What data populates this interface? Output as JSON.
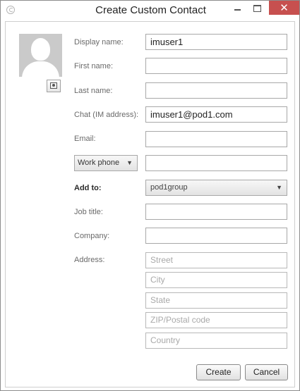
{
  "window": {
    "title": "Create Custom Contact",
    "close_glyph": "✕"
  },
  "icons": {
    "app": "app-logo-icon",
    "avatar": "person-silhouette-icon",
    "photo": "contact-card-icon",
    "dropdown": "chevron-down-icon"
  },
  "form": {
    "display_name": {
      "label": "Display name:",
      "value": "imuser1"
    },
    "first_name": {
      "label": "First name:",
      "value": ""
    },
    "last_name": {
      "label": "Last name:",
      "value": ""
    },
    "chat": {
      "label": "Chat (IM address):",
      "value": "imuser1@pod1.com"
    },
    "email": {
      "label": "Email:",
      "value": ""
    },
    "phone": {
      "type_selected": "Work phone",
      "value": ""
    },
    "add_to": {
      "label": "Add to:",
      "selected": "pod1group"
    },
    "job_title": {
      "label": "Job title:",
      "value": ""
    },
    "company": {
      "label": "Company:",
      "value": ""
    },
    "address": {
      "label": "Address:",
      "street_placeholder": "Street",
      "city_placeholder": "City",
      "state_placeholder": "State",
      "zip_placeholder": "ZIP/Postal code",
      "country_placeholder": "Country"
    }
  },
  "buttons": {
    "create": "Create",
    "cancel": "Cancel"
  },
  "colors": {
    "close_button": "#c7504f",
    "avatar_bg": "#cacaca"
  }
}
